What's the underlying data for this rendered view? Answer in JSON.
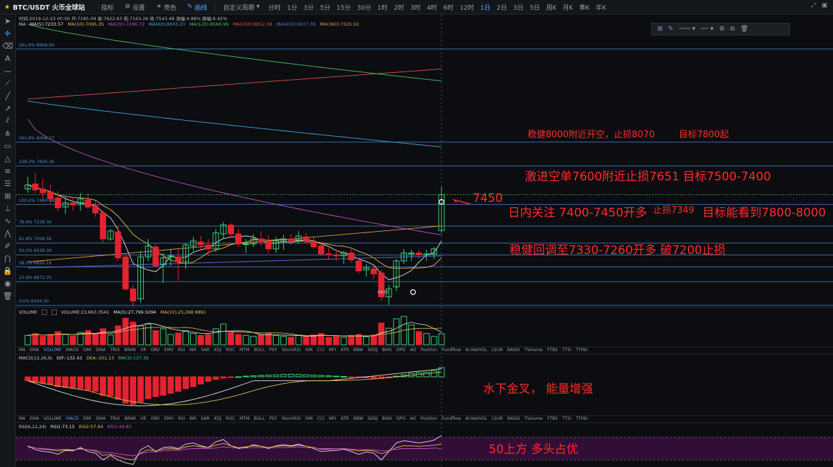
{
  "topbar": {
    "symbol": "BTC/USDT 火币全球站",
    "tools": [
      {
        "icon": "indicator-icon",
        "label": "指标"
      },
      {
        "icon": "settings-icon",
        "label": "设置"
      },
      {
        "icon": "brightness-icon",
        "label": "亮色"
      },
      {
        "icon": "drawing-icon",
        "label": "画线"
      }
    ],
    "custom_period": "自定义周期",
    "periods": [
      "分时",
      "1分",
      "3分",
      "5分",
      "15分",
      "30分",
      "1时",
      "2时",
      "3时",
      "4时",
      "6时",
      "12时",
      "1日",
      "2日",
      "3日",
      "5日",
      "周K",
      "月K",
      "季K",
      "年K"
    ],
    "active_period": "1日"
  },
  "header": {
    "ohlc": "时间:2019-12-23 00:00  开:7185.09  高:7622.83  低:7163.26  收:7543.48  涨幅:4.98%  振幅:6.42%",
    "ma_items": [
      {
        "text": "MA",
        "color": "#c8ccd2"
      },
      {
        "text": "MA(5):7233.57",
        "color": "#e6e6e6"
      },
      {
        "text": "MA(10):7095.35",
        "color": "#e6c04a"
      },
      {
        "text": "MA(30):7266.72",
        "color": "#c452c4"
      },
      {
        "text": "MA(60):8003.23",
        "color": "#3fa8e0"
      },
      {
        "text": "MA(120):8566.99",
        "color": "#4fbf6c"
      },
      {
        "text": "MA(250):8812.38",
        "color": "#e05050"
      },
      {
        "text": "MA(430):6937.38",
        "color": "#5a78d8"
      },
      {
        "text": "MA(360):7325.91",
        "color": "#e39a4a"
      }
    ]
  },
  "fib_labels": [
    "261.8% 8999.94",
    "161.8% 8068.77",
    "138.2% 7830.36",
    "100.0% 7444.48",
    "78.6% 7228.34",
    "61.8% 7058.59",
    "50.0% 6939.39",
    "38.2% 6820.19",
    "23.6% 6672.70",
    "0.0% 6434.30"
  ],
  "low_label": "6433",
  "volume_pane": {
    "title": "VOLUME",
    "items": [
      {
        "text": "VOLUME:23,663.3541",
        "color": "#c8ccd2"
      },
      {
        "text": "MA(5):27,796.5094",
        "color": "#e6e6e6"
      },
      {
        "text": "MA(10):25,268.9891",
        "color": "#e6c04a"
      }
    ]
  },
  "indicator_tabs": [
    "MA",
    "EMA",
    "VOLUME",
    "MACD",
    "DMI",
    "DMA",
    "TRIX",
    "BRAR",
    "VR",
    "OBV",
    "EMV",
    "RSI",
    "WR",
    "SAR",
    "KDJ",
    "ROC",
    "MTM",
    "BOLL",
    "PSY",
    "StochRSI",
    "SMI",
    "CCI",
    "MFI",
    "ATR",
    "BBW",
    "SKDJ",
    "BIAS",
    "DPO",
    "AO",
    "Position",
    "Fundflow",
    "AI-NetVOL",
    "LSUR",
    "BASIS",
    "TVolume",
    "FTBS",
    "TTSI",
    "TTMU"
  ],
  "macd_pane": {
    "items": [
      {
        "text": "MACD(12,26,9)",
        "color": "#c8ccd2"
      },
      {
        "text": "DIF:-132.43",
        "color": "#e6e6e6"
      },
      {
        "text": "DEA:-201.13",
        "color": "#e6c04a"
      },
      {
        "text": "MACD:137.39",
        "color": "#3fd07a"
      }
    ]
  },
  "rsi_pane": {
    "items": [
      {
        "text": "RSI(6,12,24)",
        "color": "#c8ccd2"
      },
      {
        "text": "RSI1:73.15",
        "color": "#e6e6e6"
      },
      {
        "text": "RSI2:57.94",
        "color": "#e6c04a"
      },
      {
        "text": "RSI3:49.83",
        "color": "#c452c4"
      }
    ]
  },
  "annotations": {
    "a1": "稳健8000附近开空，止损8070",
    "a1b": "目标7800起",
    "a2": "激进空单7600附近止损7651 目标7500-7400",
    "a3": "7450",
    "a4": "日内关注 7400-7450开多",
    "a4b": "止损7349",
    "a4c": "目标能看到7800-8000",
    "a5": "稳健回调至7330-7260开多  破7200止损",
    "a6": "水下金叉，  能量增强",
    "a7": "50上方  多头占优"
  },
  "colors": {
    "up": "#3fd07a",
    "down": "#e3232f",
    "fib": "#3d6ea8",
    "annotation": "#ff2b2b",
    "rsi_band": "#3a0f3f"
  },
  "chart_data": {
    "type": "candlestick",
    "ohlc": [
      [
        7600,
        7720,
        7560,
        7640
      ],
      [
        7650,
        7760,
        7560,
        7590
      ],
      [
        7600,
        7700,
        7490,
        7560
      ],
      [
        7570,
        7640,
        7460,
        7500
      ],
      [
        7510,
        7580,
        7380,
        7410
      ],
      [
        7420,
        7520,
        7350,
        7460
      ],
      [
        7460,
        7520,
        7380,
        7440
      ],
      [
        7450,
        7560,
        7380,
        7500
      ],
      [
        7490,
        7560,
        7400,
        7420
      ],
      [
        7430,
        7480,
        7320,
        7360
      ],
      [
        7360,
        7380,
        7060,
        7100
      ],
      [
        7100,
        7200,
        7080,
        7180
      ],
      [
        7170,
        7220,
        6880,
        6910
      ],
      [
        6920,
        6940,
        6580,
        6600
      ],
      [
        6600,
        6640,
        6420,
        6480
      ],
      [
        6500,
        6980,
        6460,
        6920
      ],
      [
        6920,
        7100,
        6880,
        7030
      ],
      [
        7020,
        7050,
        6820,
        6830
      ],
      [
        6840,
        6960,
        6660,
        6910
      ],
      [
        6920,
        7000,
        6830,
        6930
      ],
      [
        6920,
        7000,
        6680,
        6870
      ],
      [
        6870,
        7060,
        6800,
        7040
      ],
      [
        7030,
        7120,
        6980,
        7080
      ],
      [
        7070,
        7130,
        6990,
        7040
      ],
      [
        7040,
        7100,
        6930,
        7000
      ],
      [
        7000,
        7200,
        6970,
        7160
      ],
      [
        7150,
        7270,
        7100,
        7240
      ],
      [
        7240,
        7260,
        7110,
        7150
      ],
      [
        7150,
        7200,
        7020,
        7050
      ],
      [
        7050,
        7100,
        6960,
        7050
      ],
      [
        7050,
        7150,
        7020,
        7100
      ],
      [
        7100,
        7180,
        7030,
        7070
      ],
      [
        7080,
        7140,
        6960,
        7000
      ],
      [
        7000,
        7120,
        6960,
        7080
      ],
      [
        7080,
        7140,
        6990,
        7100
      ],
      [
        7100,
        7150,
        7040,
        7080
      ],
      [
        7090,
        7180,
        7050,
        7130
      ],
      [
        7120,
        7160,
        7050,
        7080
      ],
      [
        7070,
        7130,
        7000,
        7020
      ],
      [
        7030,
        7060,
        6930,
        6950
      ],
      [
        6950,
        7010,
        6900,
        6940
      ],
      [
        6940,
        7000,
        6880,
        6930
      ],
      [
        6930,
        6980,
        6850,
        6960
      ],
      [
        6960,
        7020,
        6860,
        6890
      ],
      [
        6880,
        6900,
        6750,
        6780
      ],
      [
        6790,
        6850,
        6720,
        6810
      ],
      [
        6800,
        6830,
        6700,
        6750
      ],
      [
        6760,
        6790,
        6480,
        6520
      ],
      [
        6520,
        6640,
        6440,
        6600
      ],
      [
        6620,
        6900,
        6580,
        6880
      ],
      [
        6880,
        7000,
        6850,
        6960
      ],
      [
        6950,
        6990,
        6880,
        6960
      ],
      [
        6960,
        6990,
        6900,
        6940
      ],
      [
        6940,
        6990,
        6880,
        6950
      ],
      [
        6950,
        7020,
        6900,
        7000
      ],
      [
        7185,
        7622,
        7163,
        7543
      ]
    ],
    "y_range": [
      6380,
      9060
    ],
    "fib_levels": [
      8999.94,
      8068.77,
      7830.36,
      7444.48,
      7228.34,
      7058.59,
      6939.39,
      6820.19,
      6672.7,
      6434.3
    ],
    "volume": [
      20,
      24,
      18,
      22,
      28,
      22,
      19,
      26,
      30,
      24,
      34,
      21,
      40,
      56,
      48,
      40,
      44,
      30,
      34,
      22,
      25,
      30,
      24,
      20,
      22,
      34,
      44,
      26,
      22,
      20,
      18,
      22,
      25,
      20,
      18,
      16,
      20,
      18,
      21,
      24,
      16,
      18,
      16,
      20,
      22,
      17,
      21,
      46,
      35,
      55,
      60,
      42,
      28,
      24,
      18,
      23.7
    ],
    "macd_hist": [
      -60,
      -80,
      -90,
      -110,
      -150,
      -160,
      -170,
      -180,
      -200,
      -220,
      -280,
      -290,
      -340,
      -400,
      -420,
      -380,
      -330,
      -300,
      -280,
      -250,
      -220,
      -180,
      -150,
      -110,
      -70,
      -40,
      -20,
      -10,
      0,
      10,
      15,
      20,
      25,
      30,
      35,
      38,
      35,
      30,
      25,
      20,
      15,
      10,
      5,
      -5,
      -10,
      -15,
      -20,
      -25,
      -15,
      10,
      30,
      50,
      60,
      70,
      90,
      137.39
    ],
    "rsi1": [
      55,
      48,
      45,
      44,
      40,
      47,
      46,
      52,
      45,
      42,
      30,
      38,
      30,
      25,
      22,
      48,
      55,
      45,
      52,
      53,
      50,
      58,
      60,
      55,
      52,
      62,
      66,
      55,
      50,
      52,
      57,
      54,
      50,
      55,
      57,
      55,
      58,
      54,
      50,
      45,
      46,
      47,
      49,
      45,
      40,
      44,
      42,
      30,
      45,
      60,
      64,
      62,
      60,
      62,
      65,
      73.15
    ],
    "rsi2": [
      54,
      51,
      49,
      48,
      46,
      48,
      47,
      50,
      48,
      46,
      38,
      40,
      36,
      32,
      30,
      42,
      48,
      46,
      49,
      50,
      49,
      53,
      55,
      53,
      52,
      56,
      59,
      55,
      52,
      53,
      55,
      54,
      52,
      54,
      55,
      54,
      56,
      54,
      52,
      49,
      49,
      50,
      50,
      48,
      46,
      47,
      46,
      41,
      45,
      52,
      55,
      55,
      54,
      55,
      56,
      57.94
    ],
    "rsi3": [
      52,
      51,
      50,
      49,
      48,
      49,
      48,
      49,
      48,
      47,
      43,
      43,
      41,
      39,
      37,
      41,
      44,
      44,
      46,
      47,
      47,
      49,
      50,
      50,
      50,
      51,
      53,
      52,
      51,
      51,
      52,
      52,
      51,
      52,
      52,
      52,
      53,
      52,
      51,
      50,
      50,
      50,
      50,
      49,
      48,
      48,
      48,
      46,
      47,
      49,
      50,
      50,
      50,
      50,
      51,
      49.83
    ]
  }
}
